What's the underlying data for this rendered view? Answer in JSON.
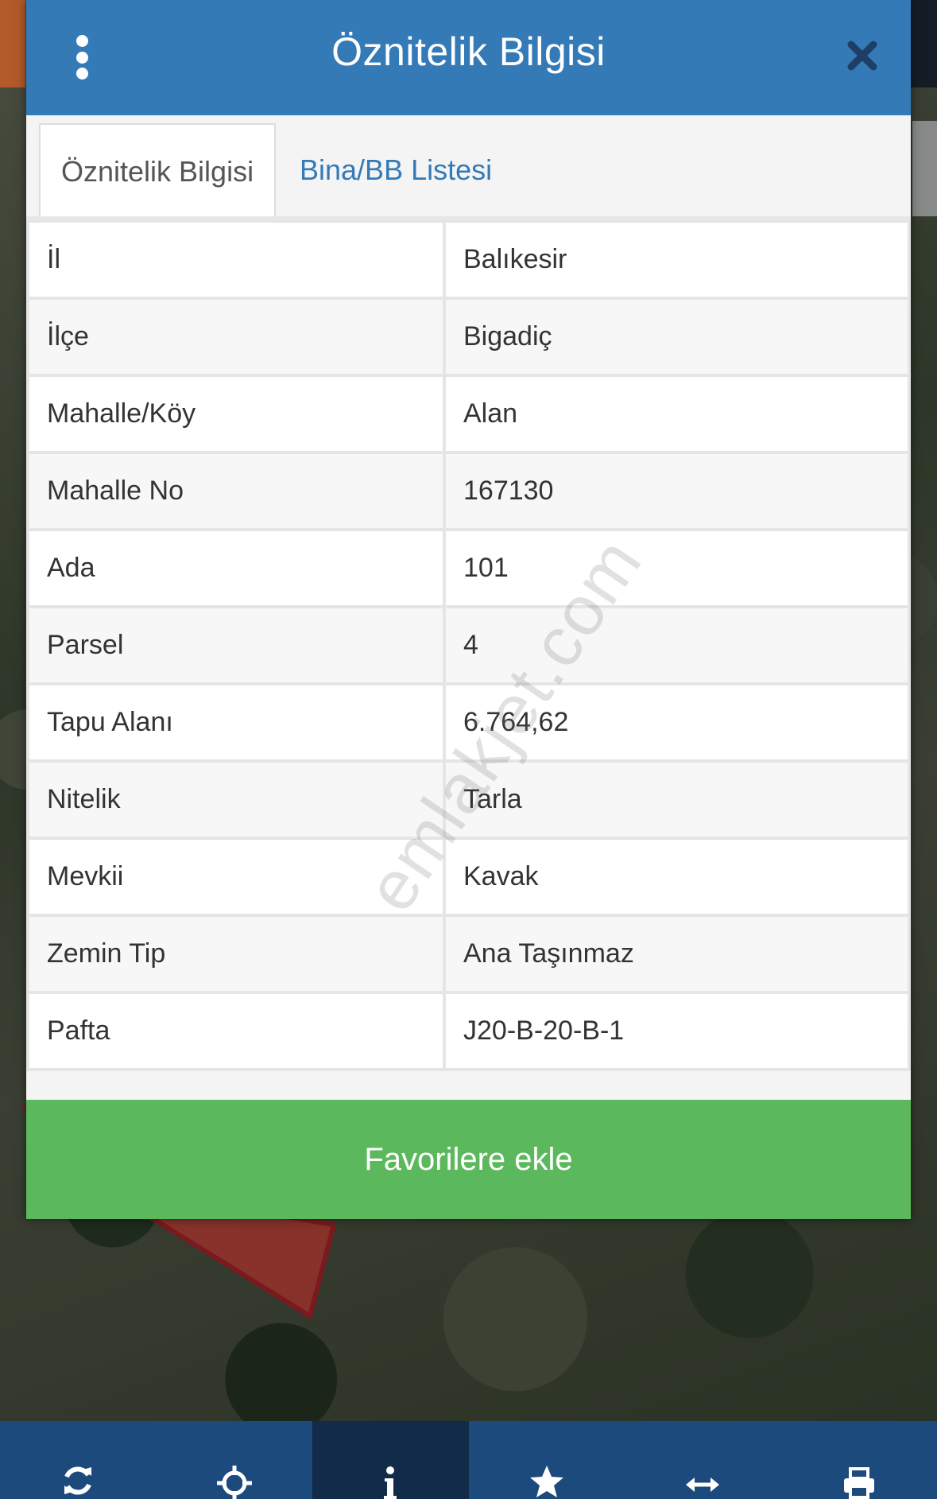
{
  "dialog": {
    "title": "Öznitelik Bilgisi"
  },
  "tabs": [
    {
      "label": "Öznitelik Bilgisi",
      "active": true
    },
    {
      "label": "Bina/BB Listesi",
      "active": false
    }
  ],
  "attributes": [
    {
      "key": "İl",
      "value": "Balıkesir"
    },
    {
      "key": "İlçe",
      "value": "Bigadiç"
    },
    {
      "key": "Mahalle/Köy",
      "value": "Alan"
    },
    {
      "key": "Mahalle No",
      "value": "167130"
    },
    {
      "key": "Ada",
      "value": "101"
    },
    {
      "key": "Parsel",
      "value": "4"
    },
    {
      "key": "Tapu Alanı",
      "value": "6.764,62"
    },
    {
      "key": "Nitelik",
      "value": "Tarla"
    },
    {
      "key": "Mevkii",
      "value": "Kavak"
    },
    {
      "key": "Zemin Tip",
      "value": "Ana Taşınmaz"
    },
    {
      "key": "Pafta",
      "value": "J20-B-20-B-1"
    }
  ],
  "favorite_button": "Favorilere ekle",
  "watermark": "emlakjet.com",
  "toolbar": [
    {
      "icon": "refresh-icon",
      "active": false
    },
    {
      "icon": "crosshair-icon",
      "active": false
    },
    {
      "icon": "info-icon",
      "active": true
    },
    {
      "icon": "star-icon",
      "active": false
    },
    {
      "icon": "measure-arrows-icon",
      "active": false
    },
    {
      "icon": "print-icon",
      "active": false
    }
  ],
  "colors": {
    "header": "#337ab7",
    "tab_link": "#337ab7",
    "favorite_button": "#5cb85c",
    "toolbar": "#1d4a7d",
    "toolbar_active": "#112b48",
    "parcel_outline": "#7a1a1e"
  }
}
